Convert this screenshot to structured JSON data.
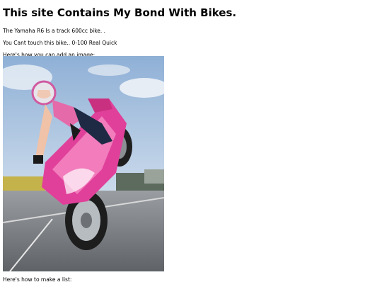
{
  "page": {
    "heading": "This site Contains My Bond With Bikes.",
    "paragraphs": [
      "The Yamaha R6 Is a track 600cc bike. .",
      "You Cant touch this bike.. 0-100 Real Quick",
      "Here's how you can add an image:"
    ],
    "list_intro": "Here's how to make a list:"
  },
  "image": {
    "subject": "rider-on-pink-motorcycle-wheelie-photo",
    "colors": {
      "sky": "#b9cde4",
      "asphalt": "#7b7f83",
      "bike_pink": "#e0409a",
      "building": "#c4b24a"
    }
  }
}
